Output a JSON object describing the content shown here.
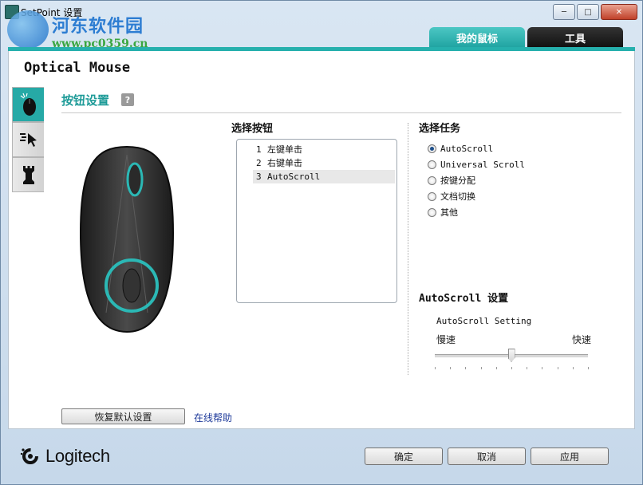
{
  "window": {
    "title": "SetPoint 设置",
    "controls": [
      "minimize",
      "maximize",
      "close"
    ]
  },
  "watermark": {
    "name": "河东软件园",
    "url": "www.pc0359.cn"
  },
  "tabs": [
    {
      "label": "我的鼠标",
      "active": true
    },
    {
      "label": "工具",
      "active": false
    }
  ],
  "device": {
    "name": "Optical Mouse"
  },
  "side_tabs": [
    {
      "icon": "mouse-buttons-icon",
      "active": true
    },
    {
      "icon": "pointer-icon",
      "active": false
    },
    {
      "icon": "chess-rook-icon",
      "active": false
    }
  ],
  "section": {
    "title": "按钮设置",
    "help": "?"
  },
  "buttons_panel": {
    "label": "选择按钮",
    "items": [
      {
        "num": "1",
        "text": "左键单击",
        "selected": false
      },
      {
        "num": "2",
        "text": "右键单击",
        "selected": false
      },
      {
        "num": "3",
        "text": "AutoScroll",
        "selected": true
      }
    ]
  },
  "task_panel": {
    "label": "选择任务",
    "options": [
      {
        "text": "AutoScroll",
        "checked": true
      },
      {
        "text": "Universal Scroll",
        "checked": false
      },
      {
        "text": "按键分配",
        "checked": false
      },
      {
        "text": "文档切换",
        "checked": false
      },
      {
        "text": "其他",
        "checked": false
      }
    ]
  },
  "autoscroll": {
    "title_en": "AutoScroll ",
    "title_cn": "设置",
    "setting_label": "AutoScroll Setting",
    "slow": "慢速",
    "fast": "快速",
    "slider_value": 0.5
  },
  "actions": {
    "restore": "恢复默认设置",
    "online_help": "在线帮助"
  },
  "footer": {
    "brand": "Logitech",
    "ok": "确定",
    "cancel": "取消",
    "apply": "应用"
  },
  "colors": {
    "accent": "#26b0ad",
    "tab_dark": "#1a1a1a",
    "link": "#1e3a9a"
  }
}
